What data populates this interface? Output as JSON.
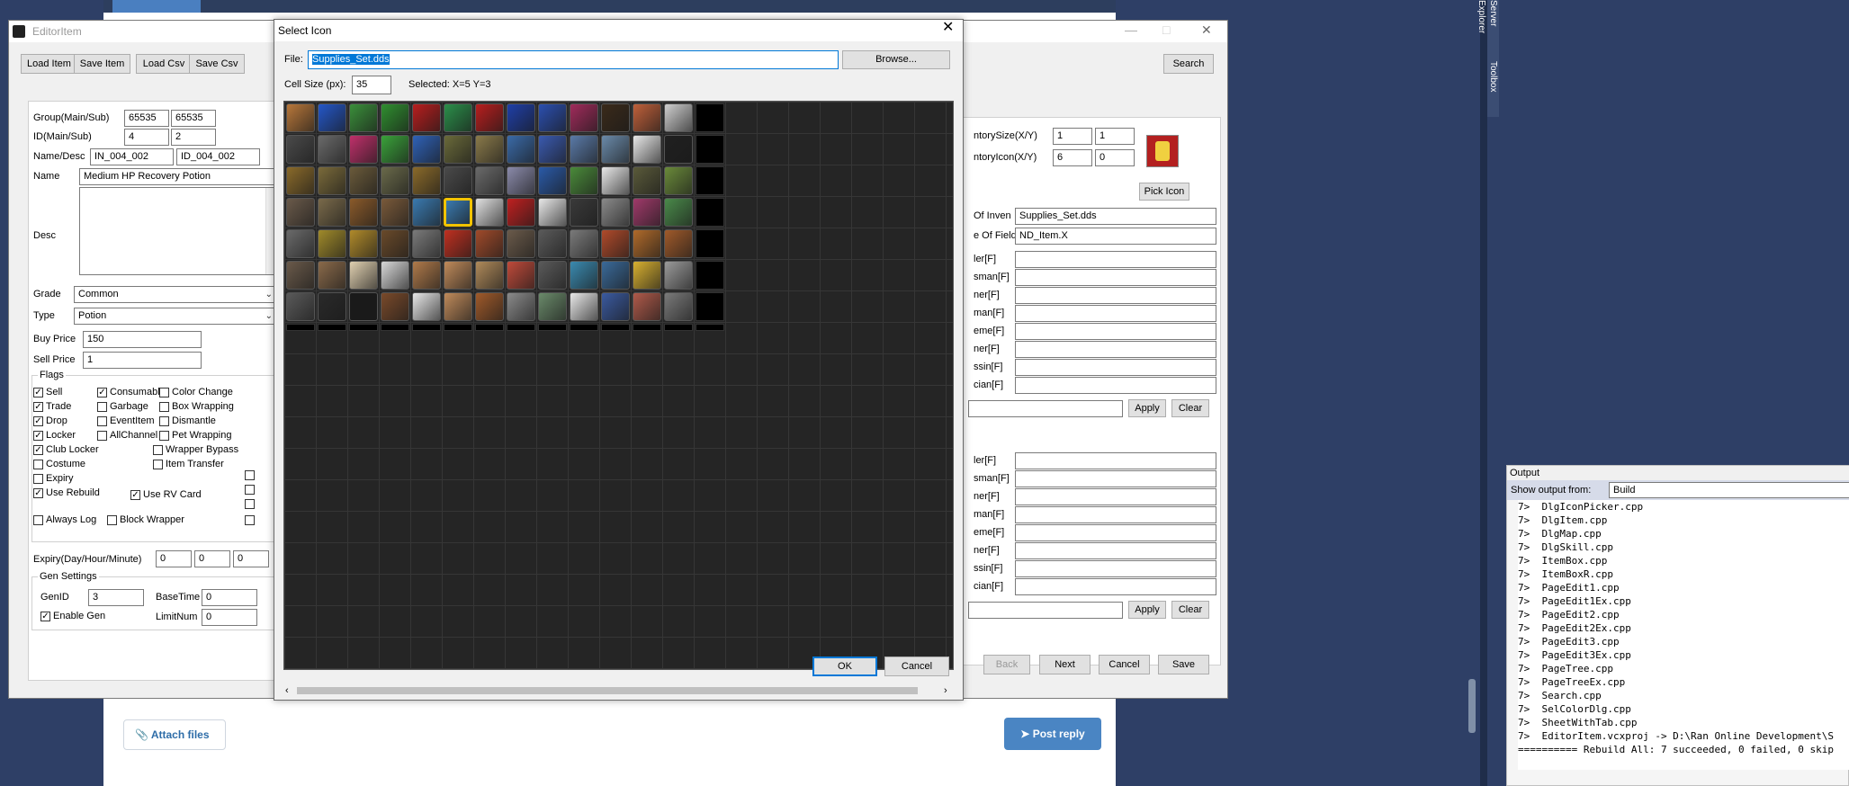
{
  "background": {
    "ide": {
      "side_tabs": [
        "Server Explorer",
        "Toolbox"
      ],
      "output": {
        "title": "Output",
        "show_output_from_label": "Show output from:",
        "show_output_from_value": "Build",
        "lines": [
          "7>  DlgIconPicker.cpp",
          "7>  DlgItem.cpp",
          "7>  DlgMap.cpp",
          "7>  DlgSkill.cpp",
          "7>  ItemBox.cpp",
          "7>  ItemBoxR.cpp",
          "7>  PageEdit1.cpp",
          "7>  PageEdit1Ex.cpp",
          "7>  PageEdit2.cpp",
          "7>  PageEdit2Ex.cpp",
          "7>  PageEdit3.cpp",
          "7>  PageEdit3Ex.cpp",
          "7>  PageTree.cpp",
          "7>  PageTreeEx.cpp",
          "7>  Search.cpp",
          "7>  SelColorDlg.cpp",
          "7>  SheetWithTab.cpp",
          "7>  EditorItem.vcxproj -> D:\\Ran Online Development\\S",
          "========== Rebuild All: 7 succeeded, 0 failed, 0 skip"
        ]
      }
    },
    "forum": {
      "attach_files_label": "Attach files",
      "post_reply_label": "Post reply"
    }
  },
  "editor": {
    "title": "EditorItem",
    "toolbar": {
      "load_item": "Load Item",
      "save_item": "Save Item",
      "load_csv": "Load Csv",
      "save_csv": "Save Csv",
      "search": "Search"
    },
    "form": {
      "group_label": "Group(Main/Sub)",
      "group_main": "65535",
      "group_sub": "65535",
      "id_label": "ID(Main/Sub)",
      "id_main": "4",
      "id_sub": "2",
      "namedesc_label": "Name/Desc",
      "name_key": "IN_004_002",
      "desc_key": "ID_004_002",
      "name_label": "Name",
      "name_value": "Medium HP Recovery Potion",
      "desc_label": "Desc",
      "grade_label": "Grade",
      "grade_value": "Common",
      "type_label": "Type",
      "type_value": "Potion",
      "buy_label": "Buy Price",
      "buy_value": "150",
      "sell_label": "Sell Price",
      "sell_value": "1",
      "flags_label": "Flags",
      "expiry_label": "Expiry(Day/Hour/Minute)",
      "expiry_values": [
        "0",
        "0",
        "0"
      ],
      "gen_settings_label": "Gen Settings",
      "genid_label": "GenID",
      "genid_value": "3",
      "basetime_label": "BaseTime",
      "basetime_value": "0",
      "enable_gen_label": "Enable Gen",
      "limitnum_label": "LimitNum",
      "limitnum_value": "0"
    },
    "flags": [
      {
        "label": "Sell",
        "checked": true
      },
      {
        "label": "Consumable",
        "checked": true
      },
      {
        "label": "Color Change",
        "checked": false
      },
      {
        "label": "Trade",
        "checked": true
      },
      {
        "label": "Garbage",
        "checked": false
      },
      {
        "label": "Box Wrapping",
        "checked": false
      },
      {
        "label": "Drop",
        "checked": true
      },
      {
        "label": "EventItem",
        "checked": false
      },
      {
        "label": "Dismantle",
        "checked": false
      },
      {
        "label": "Locker",
        "checked": true
      },
      {
        "label": "AllChannel",
        "checked": false
      },
      {
        "label": "Pet Wrapping",
        "checked": false
      },
      {
        "label": "Club Locker",
        "checked": true
      },
      {
        "label": "Wrapper Bypass",
        "checked": false
      },
      {
        "label": "Costume",
        "checked": false
      },
      {
        "label": "Item Transfer",
        "checked": false
      },
      {
        "label": "Expiry",
        "checked": false
      },
      {
        "label": "Use Rebuild",
        "checked": true
      },
      {
        "label": "Use RV Card",
        "checked": true
      },
      {
        "label": "Always Log",
        "checked": false
      },
      {
        "label": "Block Wrapper",
        "checked": false
      }
    ],
    "right": {
      "inv_size_label": "ntorySize(X/Y)",
      "inv_size_x": "1",
      "inv_size_y": "1",
      "inv_icon_label": "ntoryIcon(X/Y)",
      "inv_icon_x": "6",
      "inv_icon_y": "0",
      "pick_icon": "Pick Icon",
      "inven_label": "Of Inven",
      "inven_value": "Supplies_Set.dds",
      "field_label": "e Of Field",
      "field_value": "ND_Item.X",
      "rows_a": [
        "ler[F]",
        "sman[F]",
        "ner[F]",
        "man[F]",
        "eme[F]",
        "ner[F]",
        "ssin[F]",
        "cian[F]"
      ],
      "rows_b": [
        "ler[F]",
        "sman[F]",
        "ner[F]",
        "man[F]",
        "eme[F]",
        "ner[F]",
        "ssin[F]",
        "cian[F]"
      ],
      "apply": "Apply",
      "clear": "Clear",
      "back": "Back",
      "next": "Next",
      "cancel": "Cancel",
      "save": "Save"
    }
  },
  "dialog": {
    "title": "Select Icon",
    "file_label": "File:",
    "file_value": "Supplies_Set.dds",
    "browse": "Browse...",
    "cell_size_label": "Cell Size (px):",
    "cell_size_value": "35",
    "selected_text": "Selected: X=5  Y=3",
    "ok": "OK",
    "cancel": "Cancel",
    "grid_rows": 7,
    "grid_cols": 14,
    "selected": {
      "x": 5,
      "y": 3
    },
    "icon_colors": [
      [
        "#b8773a",
        "#2457c9",
        "#3a8f3a",
        "#2f8f2f",
        "#b81e1e",
        "#2b8f4a",
        "#b81e1e",
        "#1f3fa8",
        "#2b4fb0",
        "#a02b5b",
        "#3a2a1a",
        "#c0603a",
        "#cfcfcf"
      ],
      [
        "#4a4a4a",
        "#6a6a6a",
        "#c0306a",
        "#3aa23a",
        "#2f62b8",
        "#6a6a3a",
        "#8a7a4a",
        "#3a6aa8",
        "#3a5ab0",
        "#5a7aa8",
        "#6a8aaa",
        "#e8e8e8",
        "#202020"
      ],
      [
        "#8a6a2a",
        "#7a6a3a",
        "#6a5a3a",
        "#6a6a4a",
        "#8a6a2a",
        "#4a4a4a",
        "#6a6a6a",
        "#8a8aaa",
        "#2a5aa8",
        "#4a8a3a",
        "#e8e8e8",
        "#5a5a3a",
        "#6a8a3a"
      ],
      [
        "#6a5a4a",
        "#7a6a4a",
        "#8a5a2a",
        "#7a5a3a",
        "#3a7ab0",
        "#3a7ab0",
        "#e0e0e0",
        "#c02020",
        "#e8e8e8",
        "#3a3a3a",
        "#8a8a8a",
        "#a03a6a",
        "#4a8a4a"
      ],
      [
        "#6a6a6a",
        "#a08a2a",
        "#b08a2a",
        "#6a4a2a",
        "#7a7a7a",
        "#c03020",
        "#a04a2a",
        "#6a5a4a",
        "#5a5a5a",
        "#7a7a7a",
        "#b04a2a",
        "#b06a2a",
        "#a05a2a"
      ],
      [
        "#6a5a4a",
        "#8a6a4a",
        "#e0d0b0",
        "#d8d8d8",
        "#b07a4a",
        "#c08a5a",
        "#b08a5a",
        "#c04a3a",
        "#5a5a5a",
        "#3a8ab0",
        "#3a6a9a",
        "#d8b030",
        "#9a9a9a"
      ],
      [
        "#5a5a5a",
        "#2a2a2a",
        "#1a1a1a",
        "#7a4a2a",
        "#e8e8e8",
        "#c08a5a",
        "#a05a2a",
        "#8a8a8a",
        "#6a8a6a",
        "#e8e8e8",
        "#3a5aa0",
        "#b05a4a",
        "#7a7a7a"
      ]
    ]
  }
}
